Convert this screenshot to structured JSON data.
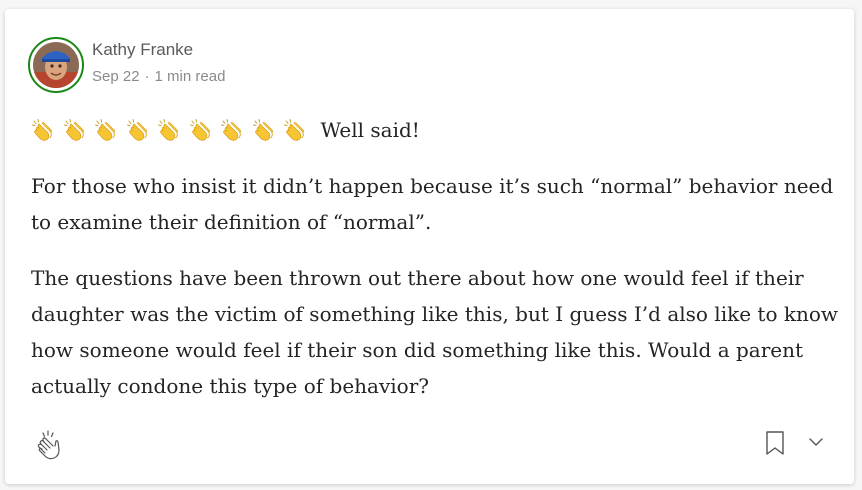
{
  "response": {
    "author": "Kathy Franke",
    "date": "Sep 22",
    "separator": "·",
    "read_time": "1 min read",
    "clap_emoji": "clapping-hands",
    "clap_emoji_count": 9,
    "clap_text": "Well said!",
    "paragraphs": [
      "For those who insist it didn’t happen because it’s such “normal” behavior need to examine their definition of “normal”.",
      "The questions have been thrown out there about how one would feel if their daughter was the victim of something like this, but I guess I’d also like to know how someone would feel if their son did something like this. Would a parent actually condone this type of behavior?"
    ]
  },
  "icons": {
    "clap": "clap-icon",
    "bookmark": "bookmark-icon",
    "more": "chevron-down-icon"
  },
  "colors": {
    "avatar_ring": "#1a8917",
    "text": "#242424",
    "meta": "#8a8a8a"
  }
}
